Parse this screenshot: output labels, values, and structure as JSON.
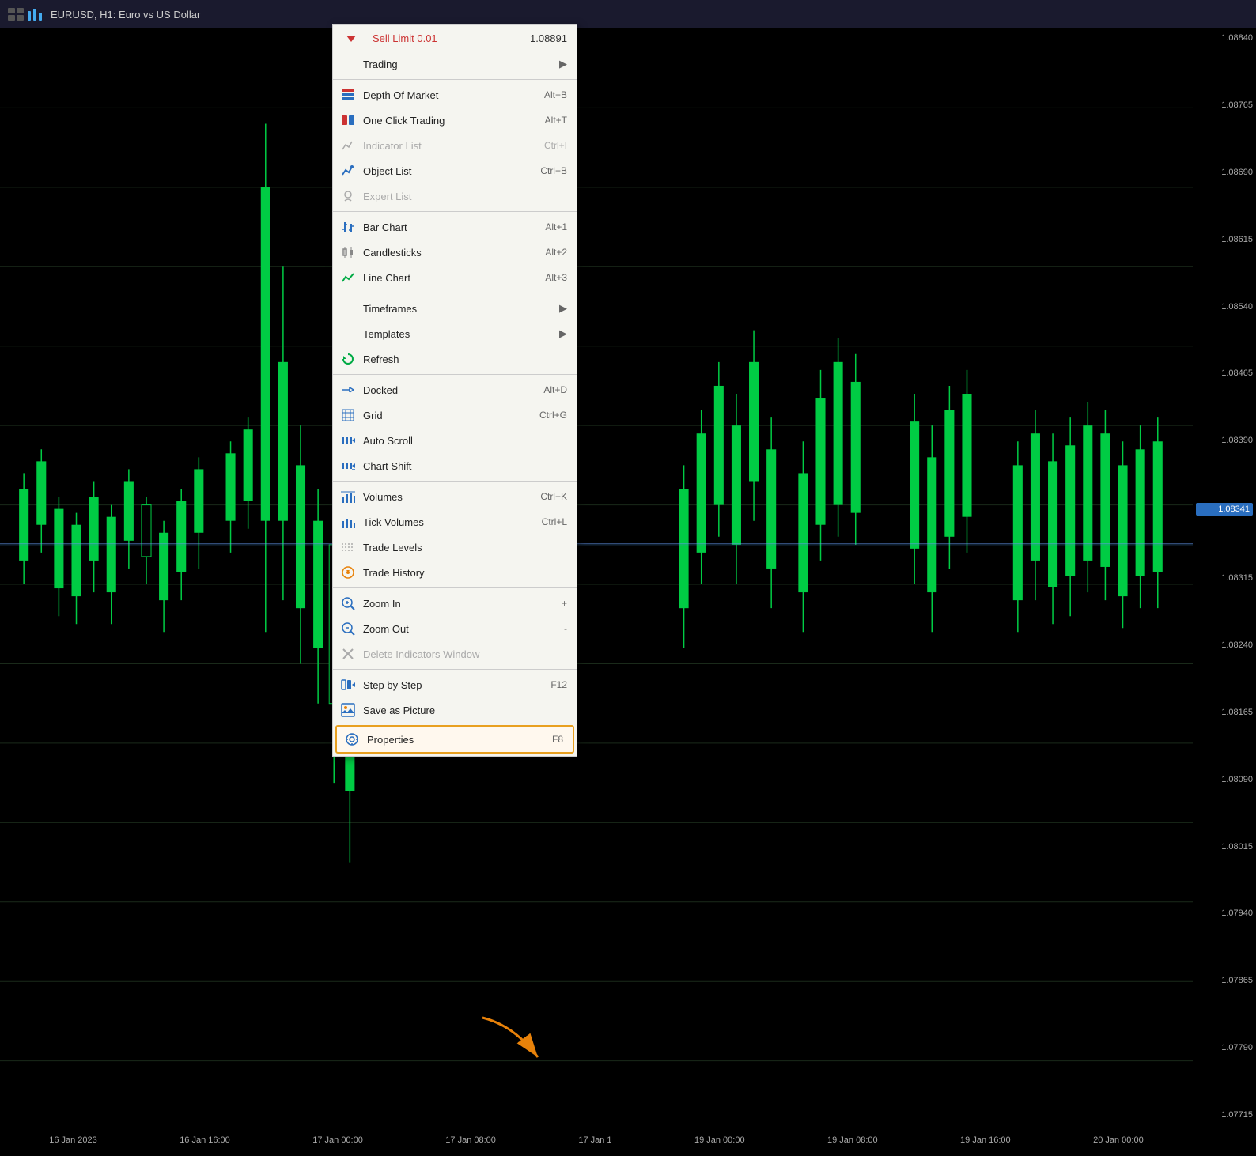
{
  "topbar": {
    "title": "EURUSD, H1:  Euro vs US Dollar"
  },
  "priceAxis": {
    "prices": [
      "1.08840",
      "1.08765",
      "1.08690",
      "1.08615",
      "1.08540",
      "1.08465",
      "1.08390",
      "1.08341",
      "1.08315",
      "1.08240",
      "1.08165",
      "1.08090",
      "1.08015",
      "1.07940",
      "1.07865",
      "1.07790",
      "1.07715"
    ],
    "highlighted": "1.08341"
  },
  "timeAxis": {
    "labels": [
      "16 Jan 2023",
      "16 Jan 16:00",
      "17 Jan 00:00",
      "17 Jan 08:00",
      "17 Jan 1",
      "19 Jan 00:00",
      "19 Jan 08:00",
      "19 Jan 16:00",
      "20 Jan 00:00"
    ]
  },
  "contextMenu": {
    "sellLimit": {
      "label": "Sell Limit 0.01",
      "price": "1.08891"
    },
    "items": [
      {
        "id": "trading",
        "label": "Trading",
        "icon": "none",
        "shortcut": "",
        "hasArrow": true,
        "disabled": false,
        "separator_after": false
      },
      {
        "id": "sep1",
        "type": "separator"
      },
      {
        "id": "depth-of-market",
        "label": "Depth Of Market",
        "icon": "dom",
        "shortcut": "Alt+B",
        "hasArrow": false,
        "disabled": false
      },
      {
        "id": "one-click-trading",
        "label": "One Click Trading",
        "icon": "oct",
        "shortcut": "Alt+T",
        "hasArrow": false,
        "disabled": false
      },
      {
        "id": "indicator-list",
        "label": "Indicator List",
        "icon": "indlist",
        "shortcut": "Ctrl+I",
        "hasArrow": false,
        "disabled": true
      },
      {
        "id": "object-list",
        "label": "Object List",
        "icon": "objlist",
        "shortcut": "Ctrl+B",
        "hasArrow": false,
        "disabled": false
      },
      {
        "id": "expert-list",
        "label": "Expert List",
        "icon": "explist",
        "shortcut": "",
        "hasArrow": false,
        "disabled": true
      },
      {
        "id": "sep2",
        "type": "separator"
      },
      {
        "id": "bar-chart",
        "label": "Bar Chart",
        "icon": "barchart",
        "shortcut": "Alt+1",
        "hasArrow": false,
        "disabled": false
      },
      {
        "id": "candlesticks",
        "label": "Candlesticks",
        "icon": "candle",
        "shortcut": "Alt+2",
        "hasArrow": false,
        "disabled": false
      },
      {
        "id": "line-chart",
        "label": "Line Chart",
        "icon": "linechart",
        "shortcut": "Alt+3",
        "hasArrow": false,
        "disabled": false
      },
      {
        "id": "sep3",
        "type": "separator"
      },
      {
        "id": "timeframes",
        "label": "Timeframes",
        "icon": "none",
        "shortcut": "",
        "hasArrow": true,
        "disabled": false
      },
      {
        "id": "templates",
        "label": "Templates",
        "icon": "none",
        "shortcut": "",
        "hasArrow": true,
        "disabled": false
      },
      {
        "id": "refresh",
        "label": "Refresh",
        "icon": "refresh",
        "shortcut": "",
        "hasArrow": false,
        "disabled": false
      },
      {
        "id": "sep4",
        "type": "separator"
      },
      {
        "id": "docked",
        "label": "Docked",
        "icon": "docked",
        "shortcut": "Alt+D",
        "hasArrow": false,
        "disabled": false
      },
      {
        "id": "grid",
        "label": "Grid",
        "icon": "grid",
        "shortcut": "Ctrl+G",
        "hasArrow": false,
        "disabled": false
      },
      {
        "id": "auto-scroll",
        "label": "Auto Scroll",
        "icon": "autoscroll",
        "shortcut": "",
        "hasArrow": false,
        "disabled": false
      },
      {
        "id": "chart-shift",
        "label": "Chart Shift",
        "icon": "chartshift",
        "shortcut": "",
        "hasArrow": false,
        "disabled": false
      },
      {
        "id": "sep5",
        "type": "separator"
      },
      {
        "id": "volumes",
        "label": "Volumes",
        "icon": "volumes",
        "shortcut": "Ctrl+K",
        "hasArrow": false,
        "disabled": false
      },
      {
        "id": "tick-volumes",
        "label": "Tick Volumes",
        "icon": "tickvol",
        "shortcut": "Ctrl+L",
        "hasArrow": false,
        "disabled": false
      },
      {
        "id": "trade-levels",
        "label": "Trade Levels",
        "icon": "tradelevel",
        "shortcut": "",
        "hasArrow": false,
        "disabled": false
      },
      {
        "id": "trade-history",
        "label": "Trade History",
        "icon": "tradehist",
        "shortcut": "",
        "hasArrow": false,
        "disabled": false
      },
      {
        "id": "sep6",
        "type": "separator"
      },
      {
        "id": "zoom-in",
        "label": "Zoom In",
        "icon": "zoomin",
        "shortcut": "+",
        "hasArrow": false,
        "disabled": false
      },
      {
        "id": "zoom-out",
        "label": "Zoom Out",
        "icon": "zoomout",
        "shortcut": "-",
        "hasArrow": false,
        "disabled": false
      },
      {
        "id": "delete-indicators",
        "label": "Delete Indicators Window",
        "icon": "delete",
        "shortcut": "",
        "hasArrow": false,
        "disabled": true
      },
      {
        "id": "sep7",
        "type": "separator"
      },
      {
        "id": "step-by-step",
        "label": "Step by Step",
        "icon": "step",
        "shortcut": "F12",
        "hasArrow": false,
        "disabled": false
      },
      {
        "id": "save-as-picture",
        "label": "Save as Picture",
        "icon": "savepic",
        "shortcut": "",
        "hasArrow": false,
        "disabled": false
      },
      {
        "id": "properties",
        "label": "Properties",
        "icon": "props",
        "shortcut": "F8",
        "hasArrow": false,
        "disabled": false,
        "highlighted": true
      }
    ]
  }
}
